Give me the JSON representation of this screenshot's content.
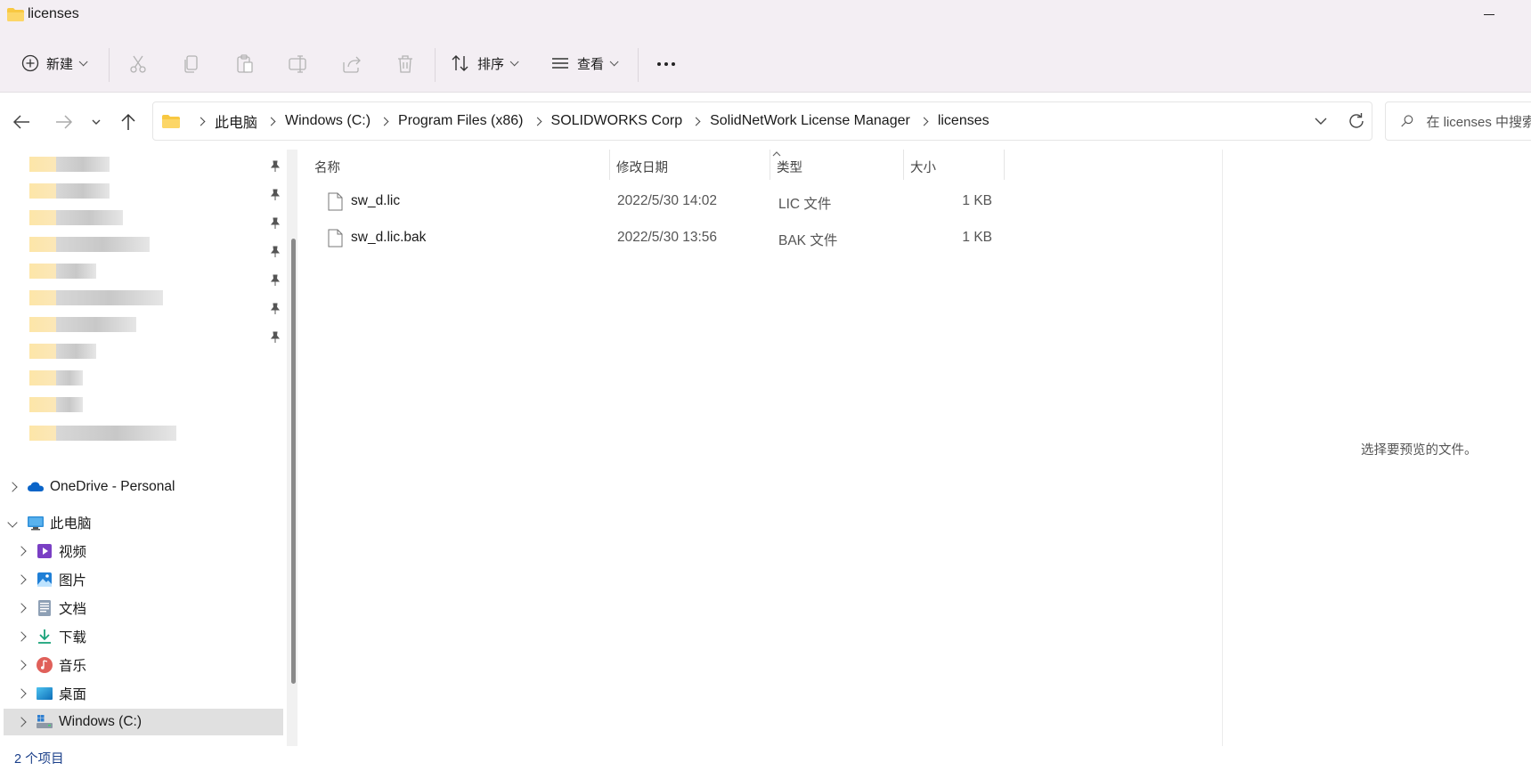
{
  "window": {
    "title": "licenses",
    "minimize_icon": "minimize-icon"
  },
  "toolbar": {
    "new_label": "新建",
    "sort_label": "排序",
    "view_label": "查看",
    "icons": [
      "cut-icon",
      "copy-icon",
      "paste-icon",
      "rename-icon",
      "share-icon",
      "delete-icon",
      "more-icon"
    ]
  },
  "address": {
    "crumbs": [
      "此电脑",
      "Windows (C:)",
      "Program Files (x86)",
      "SOLIDWORKS Corp",
      "SolidNetWork License Manager",
      "licenses"
    ]
  },
  "search": {
    "placeholder": "在 licenses 中搜索"
  },
  "sidebar": {
    "onedrive": "OneDrive - Personal",
    "this_pc": "此电脑",
    "items": [
      {
        "label": "视频",
        "icon": "videos-icon"
      },
      {
        "label": "图片",
        "icon": "pictures-icon"
      },
      {
        "label": "文档",
        "icon": "documents-icon"
      },
      {
        "label": "下载",
        "icon": "downloads-icon"
      },
      {
        "label": "音乐",
        "icon": "music-icon"
      },
      {
        "label": "桌面",
        "icon": "desktop-icon"
      },
      {
        "label": "Windows (C:)",
        "icon": "drive-icon"
      }
    ]
  },
  "columns": {
    "name": "名称",
    "date": "修改日期",
    "type": "类型",
    "size": "大小"
  },
  "files": [
    {
      "name": "sw_d.lic",
      "date": "2022/5/30 14:02",
      "type": "LIC 文件",
      "size": "1 KB"
    },
    {
      "name": "sw_d.lic.bak",
      "date": "2022/5/30 13:56",
      "type": "BAK 文件",
      "size": "1 KB"
    }
  ],
  "preview": {
    "message": "选择要预览的文件。"
  },
  "status": {
    "count": "2 个项目"
  },
  "colors": {
    "accent": "#0067c0",
    "title_bg": "#f3eef3",
    "folder": "#f8c841"
  }
}
